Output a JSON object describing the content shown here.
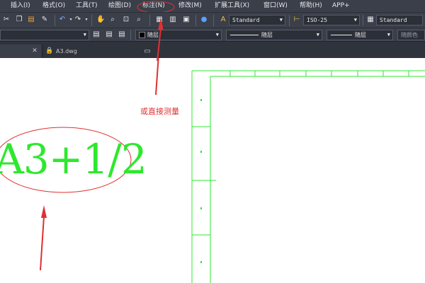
{
  "menubar": {
    "items": [
      "插入(I)",
      "格式(O)",
      "工具(T)",
      "绘图(D)",
      "标注(N)",
      "修改(M)",
      "扩展工具(X)",
      "窗口(W)",
      "帮助(H)",
      "APP+"
    ]
  },
  "toolbar1": {
    "text_style": "Standard",
    "dim_style": "ISO-25",
    "table_style": "Standard"
  },
  "toolbar2": {
    "layer_name": "随层",
    "linetype": "随层",
    "lineweight": "随层",
    "color": "随颜色"
  },
  "tabs": {
    "document_name": "A3.dwg"
  },
  "canvas": {
    "drawing_text": "A3+1/2",
    "hint_text": "或直接测量"
  },
  "colors": {
    "ui_bg": "#3a3f4a",
    "drawing_green": "#2ee82e",
    "annotation_red": "#e03030"
  },
  "icons": [
    "cut-icon",
    "copy-icon",
    "paste-icon",
    "match-properties-icon",
    "undo-icon",
    "redo-icon",
    "pan-icon",
    "zoom-realtime-icon",
    "zoom-window-icon",
    "zoom-previous-icon",
    "properties-icon",
    "design-center-icon",
    "tool-palette-icon",
    "help-icon",
    "text-style-icon",
    "dim-style-icon",
    "table-style-icon",
    "layer-state-icon",
    "layer-manager-icon",
    "layer-previous-icon",
    "close-icon",
    "lock-icon",
    "new-tab-icon"
  ]
}
